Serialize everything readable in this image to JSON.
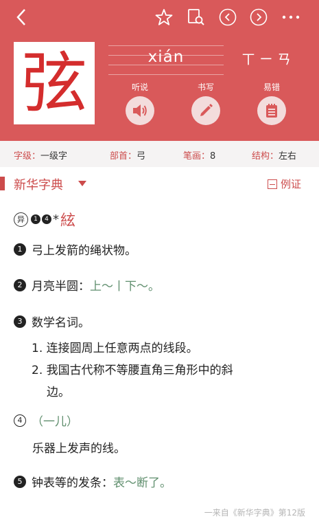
{
  "header": {
    "character": "弦",
    "pinyin": "xián",
    "zhuyin": "ㄒㄧㄢ",
    "actions": [
      {
        "label": "听说",
        "icon": "speaker-icon"
      },
      {
        "label": "书写",
        "icon": "pencil-icon"
      },
      {
        "label": "易错",
        "icon": "notepad-icon"
      }
    ]
  },
  "info": {
    "level_key": "字级",
    "level_val": "一级字",
    "radical_key": "部首",
    "radical_val": "弓",
    "strokes_key": "笔画",
    "strokes_val": "8",
    "structure_key": "结构",
    "structure_val": "左右"
  },
  "section": {
    "title": "新华字典",
    "example_label": "例证"
  },
  "variant": {
    "badge": "异",
    "nums": [
      "1",
      "4"
    ],
    "star": "*",
    "char": "絃"
  },
  "definitions": {
    "d1": {
      "num": "1",
      "text": "弓上发箭的绳状物。"
    },
    "d2": {
      "num": "2",
      "text": "月亮半圆：",
      "example": "上～丨下～。"
    },
    "d3": {
      "num": "3",
      "text": "数学名词。",
      "s1": "1. 连接圆周上任意两点的线段。",
      "s2": "2. 我国古代称不等腰直角三角形中的斜",
      "s2_cont": "边。"
    },
    "d4": {
      "num": "4",
      "paren": "（一儿）",
      "text": "乐器上发声的线。"
    },
    "d5": {
      "num": "5",
      "text": "钟表等的发条：",
      "example": "表～断了。"
    }
  },
  "source": "一来自《新华字典》第12版",
  "colors": {
    "accent": "#d9595a",
    "text_red": "#cc4b4b",
    "example_green": "#5f8e6d"
  }
}
